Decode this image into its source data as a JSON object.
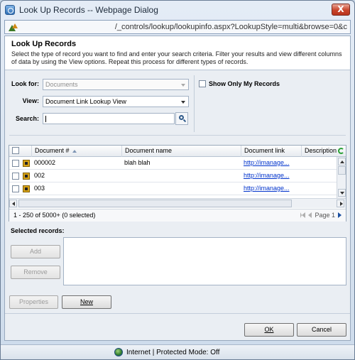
{
  "window": {
    "title": "Look Up Records -- Webpage Dialog",
    "close_label": "X",
    "address": "/_controls/lookup/lookupinfo.aspx?LookupStyle=multi&browse=0&c"
  },
  "header": {
    "title": "Look Up Records",
    "description": "Select the type of record you want to find and enter your search criteria. Filter your results and view different columns of data by using the View options. Repeat this process for different types of records."
  },
  "form": {
    "look_for_label": "Look for:",
    "look_for_value": "Documents",
    "view_label": "View:",
    "view_value": "Document Link Lookup View",
    "search_label": "Search:",
    "search_value": "",
    "show_only_mine_label": "Show Only My Records",
    "show_only_mine_checked": false
  },
  "grid": {
    "columns": [
      "Document #",
      "Document name",
      "Document link",
      "Description"
    ],
    "rows": [
      {
        "number": "000002",
        "name": "blah blah",
        "link": "http://imanage..."
      },
      {
        "number": "002",
        "name": "",
        "link": "http://imanage..."
      },
      {
        "number": "003",
        "name": "",
        "link": "http://imanage..."
      }
    ],
    "record_count": "1 - 250 of 5000+ (0 selected)",
    "page_label": "Page 1"
  },
  "selected": {
    "label": "Selected records:",
    "add_label": "Add",
    "remove_label": "Remove"
  },
  "actions": {
    "properties_label": "Properties",
    "new_label": "New",
    "ok_label": "OK",
    "cancel_label": "Cancel"
  },
  "status": {
    "text": "Internet | Protected Mode: Off"
  },
  "colors": {
    "link": "#0033cc",
    "close_button": "#c9442a"
  }
}
